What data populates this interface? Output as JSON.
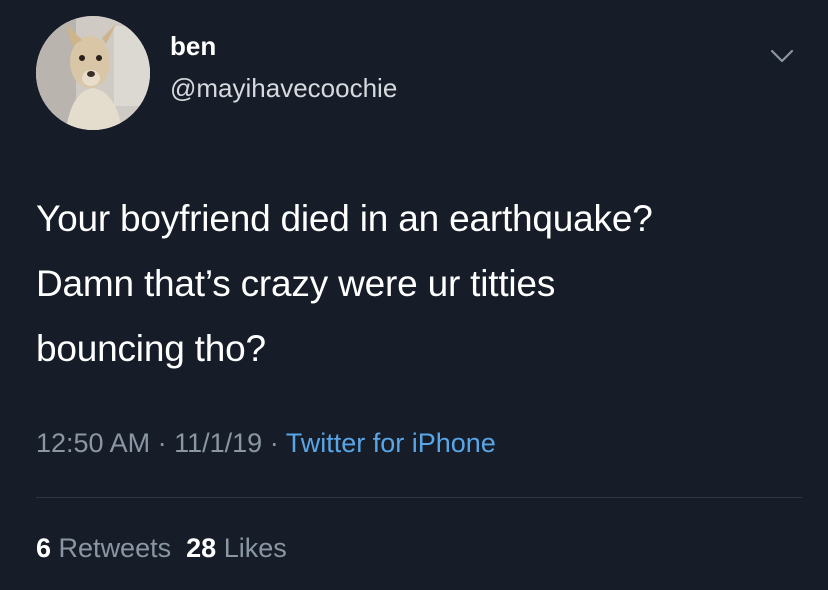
{
  "user": {
    "display_name": "ben",
    "handle": "@mayihavecoochie",
    "avatar_icon": "dog-avatar"
  },
  "header": {
    "menu_icon": "chevron-down-icon"
  },
  "tweet": {
    "lines": [
      "Your boyfriend died in an earthquake?",
      "Damn that’s crazy were ur titties",
      "bouncing tho?"
    ]
  },
  "meta": {
    "time": "12:50 AM",
    "date": "11/1/19",
    "source": "Twitter for iPhone",
    "separator": "·"
  },
  "stats": {
    "retweets_count": "6",
    "retweets_label": "Retweets",
    "likes_count": "28",
    "likes_label": "Likes"
  },
  "colors": {
    "background": "#161d29",
    "link": "#5aa5e6",
    "muted": "#8b96a3"
  }
}
